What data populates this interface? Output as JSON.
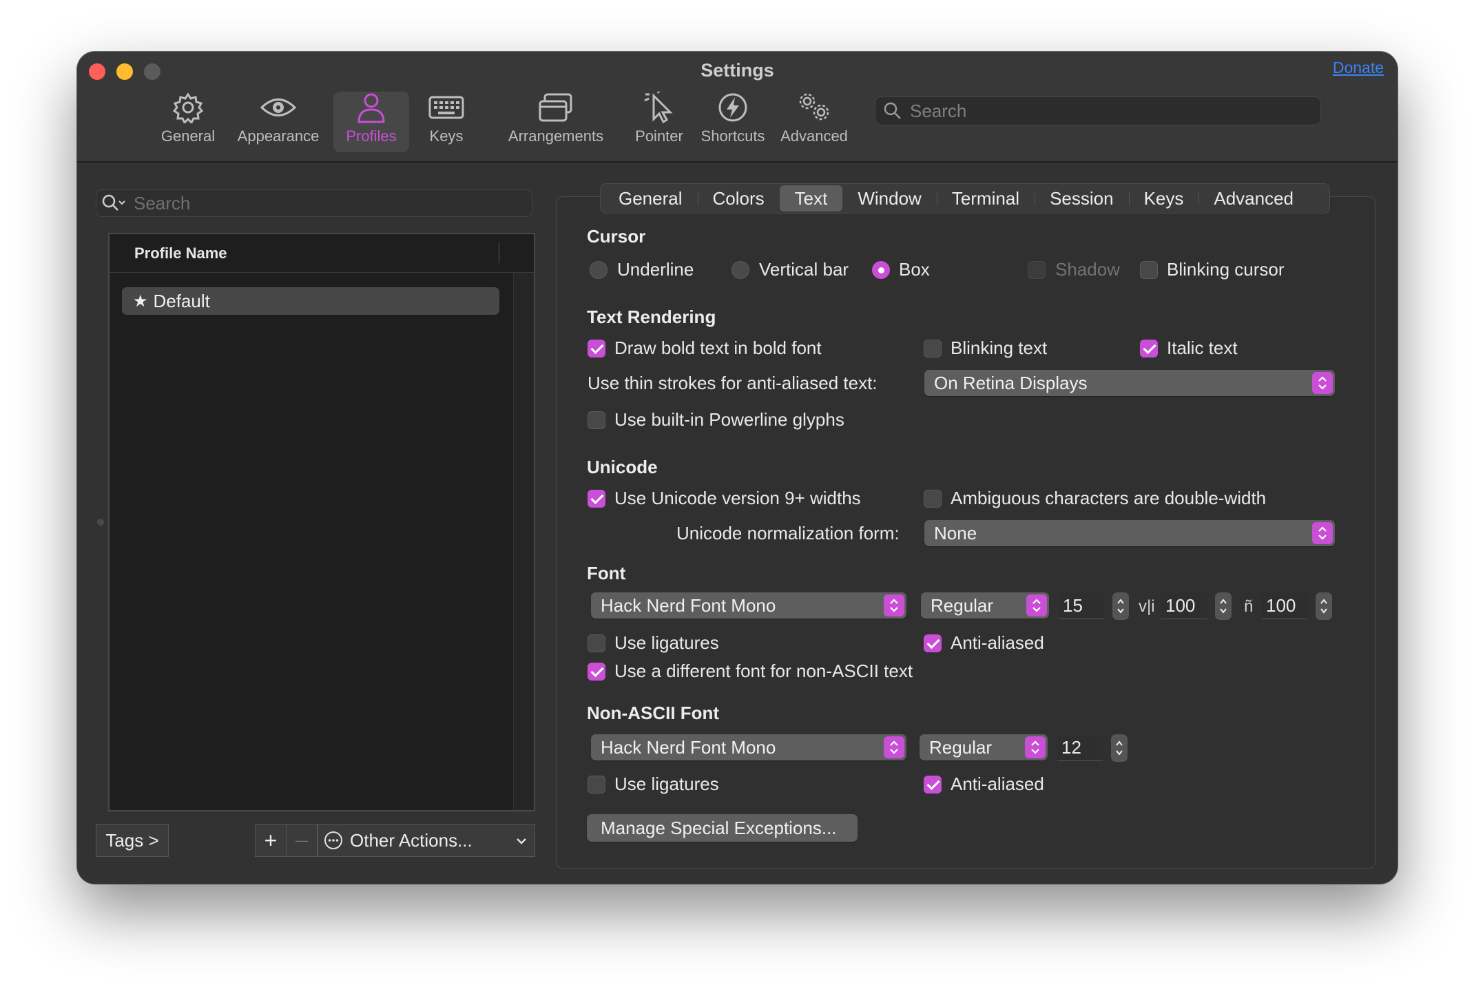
{
  "window": {
    "title": "Settings",
    "donate_label": "Donate"
  },
  "toolbar": {
    "items": [
      {
        "label": "General",
        "icon": "gear-icon"
      },
      {
        "label": "Appearance",
        "icon": "eye-icon"
      },
      {
        "label": "Profiles",
        "icon": "person-icon",
        "active": true
      },
      {
        "label": "Keys",
        "icon": "keyboard-icon"
      },
      {
        "label": "Arrangements",
        "icon": "windows-icon"
      },
      {
        "label": "Pointer",
        "icon": "pointer-icon"
      },
      {
        "label": "Shortcuts",
        "icon": "bolt-icon"
      },
      {
        "label": "Advanced",
        "icon": "gears-icon"
      }
    ],
    "search_placeholder": "Search"
  },
  "sidebar": {
    "search_placeholder": "Search",
    "column_header": "Profile Name",
    "profiles": [
      {
        "name": "Default",
        "icon": "star-icon",
        "selected": true
      }
    ],
    "tags_label": "Tags >",
    "add_label": "+",
    "remove_label": "—",
    "other_actions_label": "Other Actions..."
  },
  "tabs": [
    {
      "label": "General"
    },
    {
      "label": "Colors"
    },
    {
      "label": "Text",
      "active": true
    },
    {
      "label": "Window"
    },
    {
      "label": "Terminal"
    },
    {
      "label": "Session"
    },
    {
      "label": "Keys"
    },
    {
      "label": "Advanced"
    }
  ],
  "cursor": {
    "heading": "Cursor",
    "underline_label": "Underline",
    "vertical_bar_label": "Vertical bar",
    "box_label": "Box",
    "selected": "Box",
    "shadow_label": "Shadow",
    "shadow_checked": false,
    "blinking_label": "Blinking cursor",
    "blinking_checked": false
  },
  "text_rendering": {
    "heading": "Text Rendering",
    "bold_label": "Draw bold text in bold font",
    "bold_checked": true,
    "blinking_text_label": "Blinking text",
    "blinking_text_checked": false,
    "italic_label": "Italic text",
    "italic_checked": true,
    "thin_strokes_label": "Use thin strokes for anti-aliased text:",
    "thin_strokes_value": "On Retina Displays",
    "powerline_label": "Use built-in Powerline glyphs",
    "powerline_checked": false
  },
  "unicode": {
    "heading": "Unicode",
    "widths_label": "Use Unicode version 9+ widths",
    "widths_checked": true,
    "ambiguous_label": "Ambiguous characters are double-width",
    "ambiguous_checked": false,
    "normalization_label": "Unicode normalization form:",
    "normalization_value": "None"
  },
  "font": {
    "heading": "Font",
    "family": "Hack Nerd Font Mono",
    "style": "Regular",
    "size": "15",
    "vertical_spacing": "100",
    "horizontal_spacing": "100",
    "ligatures_label": "Use ligatures",
    "ligatures_checked": false,
    "antialiased_label": "Anti-aliased",
    "antialiased_checked": true,
    "non_ascii_toggle_label": "Use a different font for non-ASCII text",
    "non_ascii_toggle_checked": true,
    "vertical_spacing_glyph": "v|i",
    "horizontal_spacing_glyph": "ñ"
  },
  "non_ascii_font": {
    "heading": "Non-ASCII Font",
    "family": "Hack Nerd Font Mono",
    "style": "Regular",
    "size": "12",
    "ligatures_label": "Use ligatures",
    "ligatures_checked": false,
    "antialiased_label": "Anti-aliased",
    "antialiased_checked": true
  },
  "exceptions_button_label": "Manage Special Exceptions...",
  "colors": {
    "accent": "#c84fd6",
    "link": "#3b82f6",
    "window_bg": "#323232"
  }
}
